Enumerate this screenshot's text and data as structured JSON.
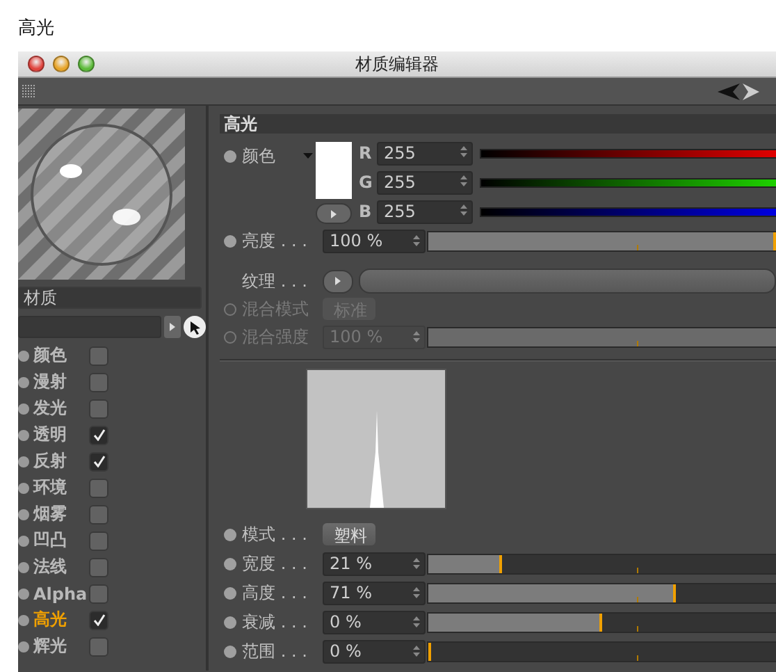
{
  "page_title": "高光",
  "window": {
    "title": "材质编辑器"
  },
  "material_name": "材质",
  "channels": [
    {
      "label": "颜色",
      "checked": false,
      "selected": false
    },
    {
      "label": "漫射",
      "checked": false,
      "selected": false
    },
    {
      "label": "发光",
      "checked": false,
      "selected": false
    },
    {
      "label": "透明",
      "checked": true,
      "selected": false
    },
    {
      "label": "反射",
      "checked": true,
      "selected": false
    },
    {
      "label": "环境",
      "checked": false,
      "selected": false
    },
    {
      "label": "烟雾",
      "checked": false,
      "selected": false
    },
    {
      "label": "凹凸",
      "checked": false,
      "selected": false
    },
    {
      "label": "法线",
      "checked": false,
      "selected": false
    },
    {
      "label": "Alpha",
      "checked": false,
      "selected": false
    },
    {
      "label": "高光",
      "checked": true,
      "selected": true
    },
    {
      "label": "辉光",
      "checked": false,
      "selected": false
    }
  ],
  "section_title": "高光",
  "color": {
    "label": "颜色",
    "components": [
      {
        "label": "R",
        "value": "255",
        "kind": "red",
        "level": 1
      },
      {
        "label": "G",
        "value": "255",
        "kind": "green",
        "level": 1
      },
      {
        "label": "B",
        "value": "255",
        "kind": "blue",
        "level": 1
      }
    ]
  },
  "brightness": {
    "label": "亮度 . . .",
    "value": "100 %",
    "level": 1
  },
  "texture": {
    "label": "纹理 . . ."
  },
  "blend_mode": {
    "label": "混合模式",
    "value": "标准",
    "disabled": true
  },
  "blend_strength": {
    "label": "混合强度",
    "value": "100 %",
    "level": 1,
    "disabled": true
  },
  "params": [
    {
      "kind": "dropdown",
      "label": "模式 . . .",
      "value": "塑料"
    },
    {
      "kind": "slider",
      "label": "宽度 . . .",
      "value": "21 %",
      "level": 0.21
    },
    {
      "kind": "slider",
      "label": "高度 . . .",
      "value": "71 %",
      "level": 0.71
    },
    {
      "kind": "slider",
      "label": "衰减 . . .",
      "value": "0 %",
      "level": 0.5
    },
    {
      "kind": "slider",
      "label": "范围 . . .",
      "value": "0 %",
      "level": 0
    }
  ]
}
